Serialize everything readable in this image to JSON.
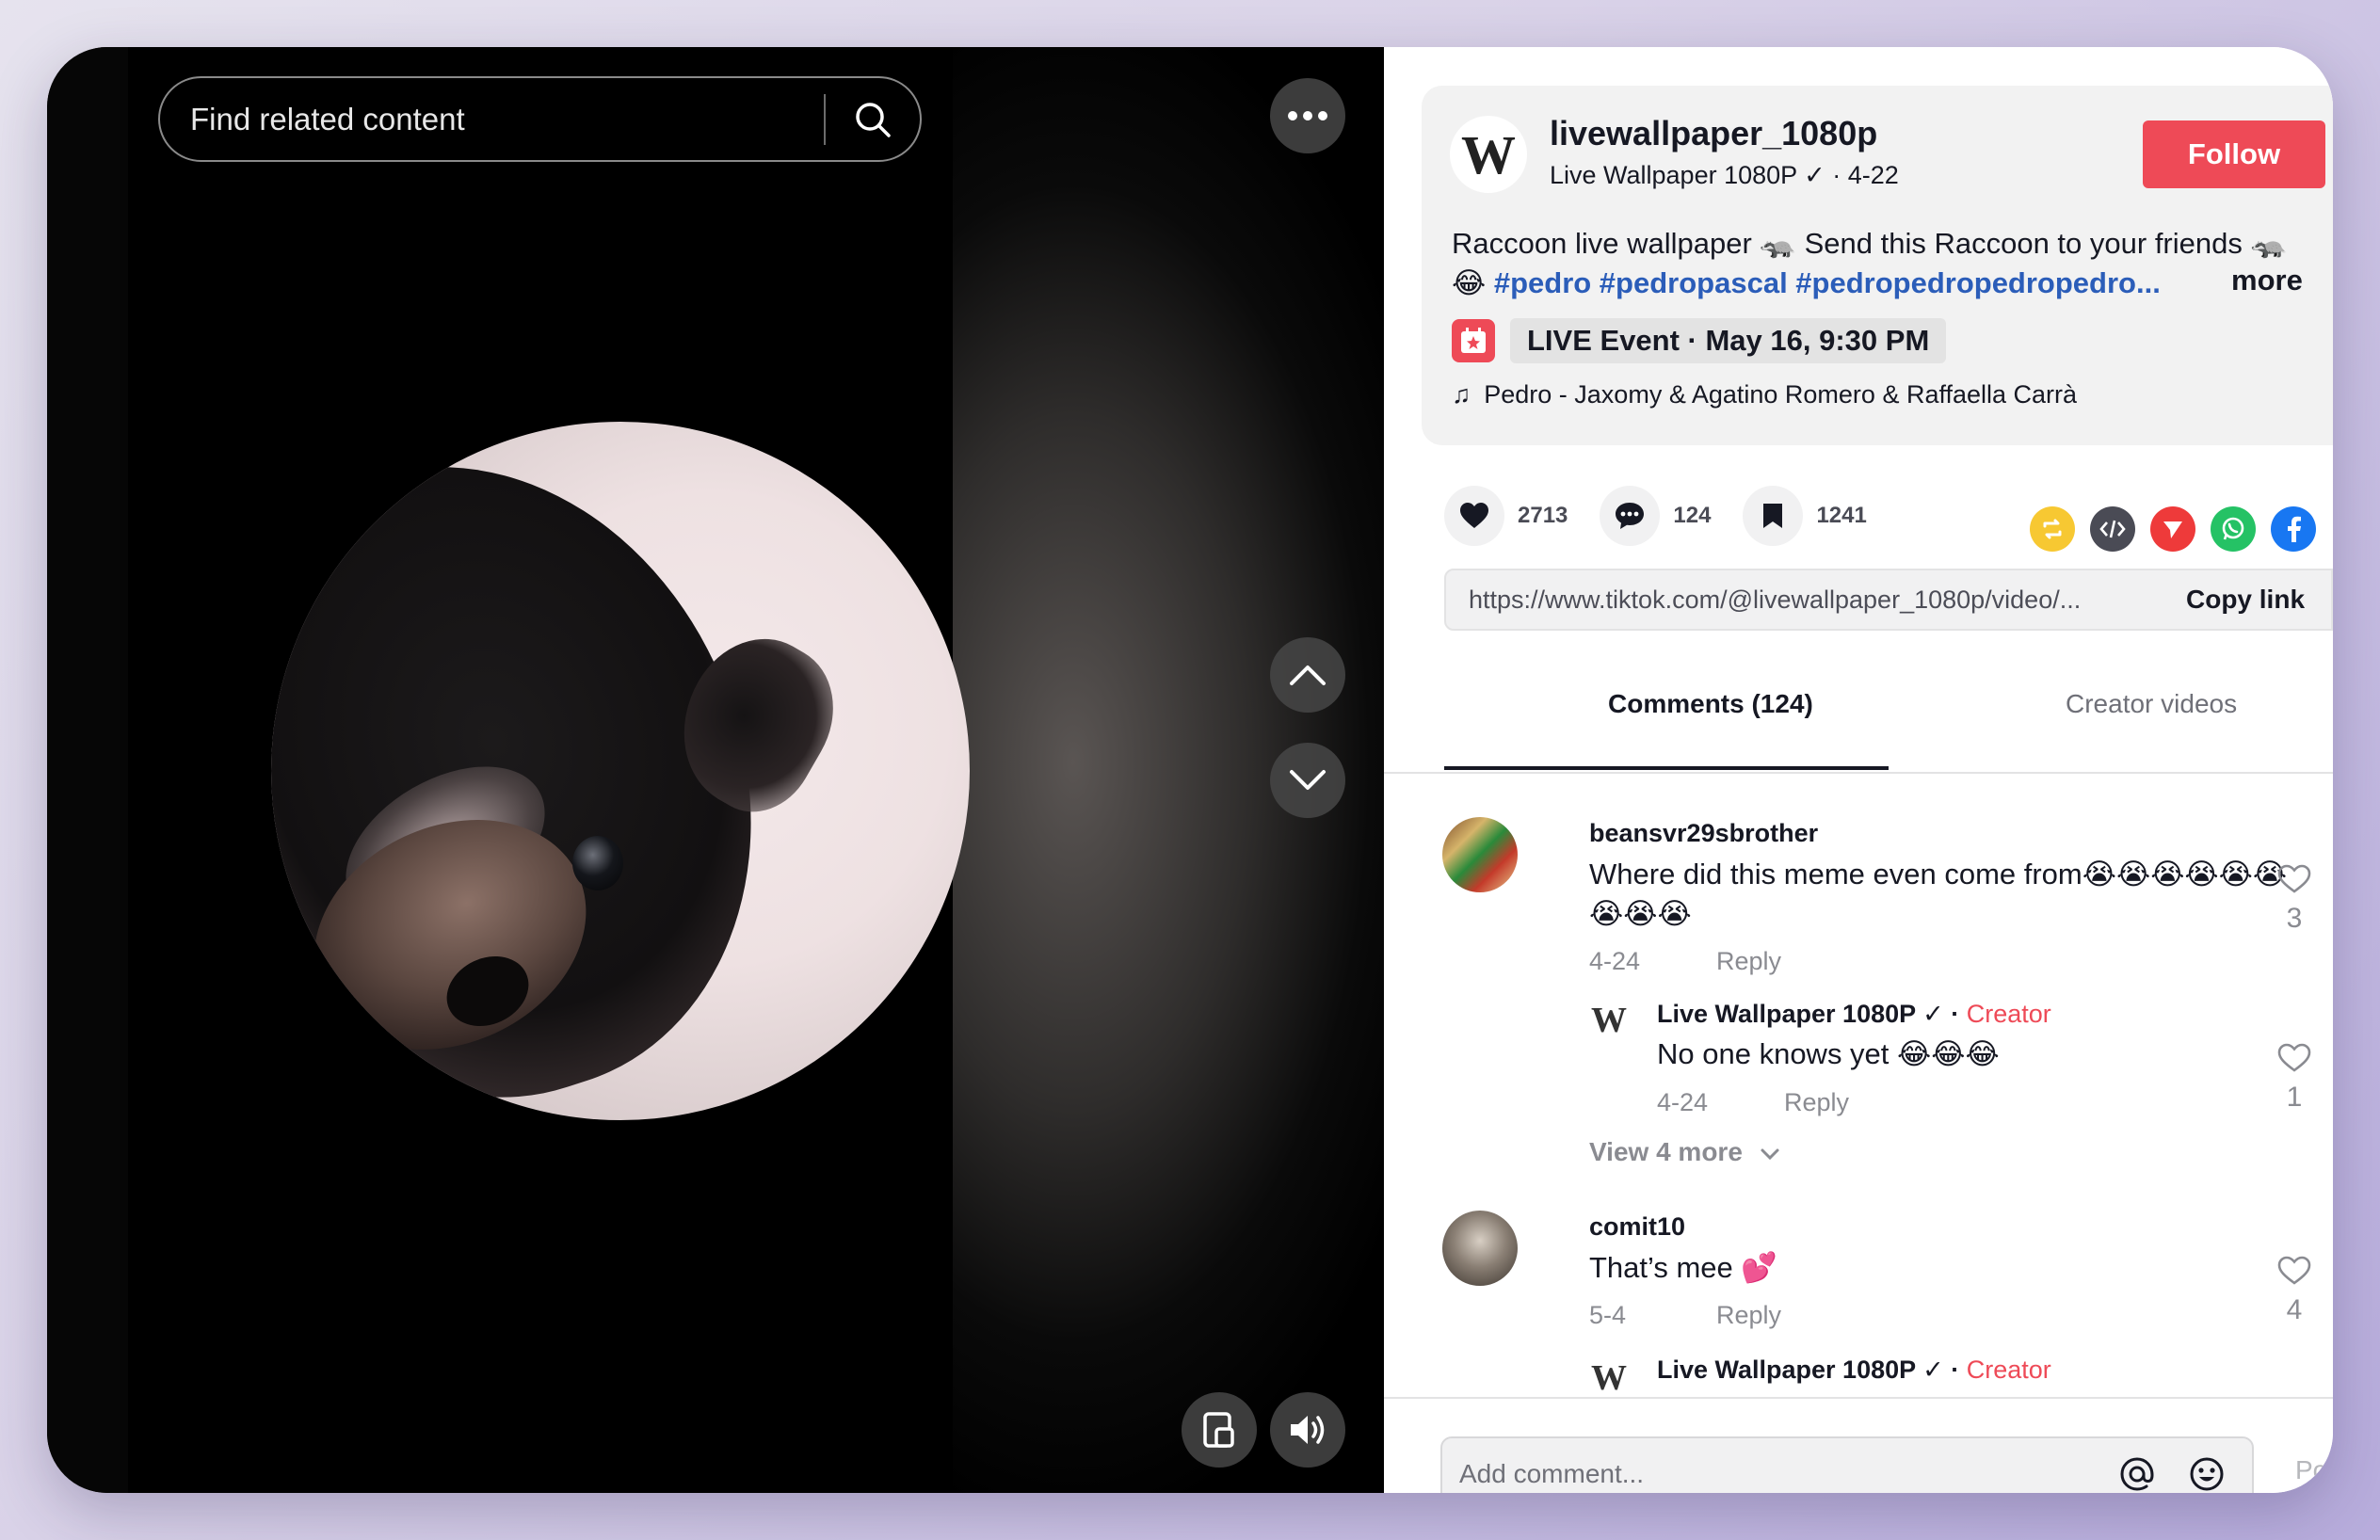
{
  "search": {
    "placeholder": "Find related content"
  },
  "author": {
    "avatar_letter": "W",
    "handle": "livewallpaper_1080p",
    "subtitle": "Live Wallpaper 1080P ✓ · 4-22",
    "follow_label": "Follow"
  },
  "description": {
    "text": "Raccoon live wallpaper 🦡 Send this Raccoon to your friends 🦡 😂 ",
    "hashtags": "#pedro #pedropascal #pedropedropedropedro...",
    "more_label": "more"
  },
  "live_event": {
    "label": "LIVE Event · May 16, 9:30 PM"
  },
  "music": {
    "note_icon": "♫",
    "title": "Pedro - Jaxomy & Agatino Romero & Raffaella Carrà"
  },
  "actions": {
    "likes": "2713",
    "comments": "124",
    "saves": "1241"
  },
  "link": {
    "url": "https://www.tiktok.com/@livewallpaper_1080p/video/...",
    "copy_label": "Copy link"
  },
  "tabs": {
    "comments": "Comments (124)",
    "creator_videos": "Creator videos"
  },
  "comments": [
    {
      "user": "beansvr29sbrother",
      "text_line1": "Where did this meme even come from😭😭😭😭😭😭",
      "text_line2": "😭😭😭",
      "date": "4-24",
      "reply_label": "Reply",
      "likes": "3",
      "reply": {
        "user": "Live Wallpaper 1080P ✓ · ",
        "creator_tag": "Creator",
        "text": "No one knows yet 😂😂😂",
        "date": "4-24",
        "reply_label": "Reply",
        "likes": "1"
      },
      "view_more": "View 4 more"
    },
    {
      "user": "comit10",
      "text": "That’s mee 💕",
      "date": "5-4",
      "reply_label": "Reply",
      "likes": "4",
      "reply": {
        "user": "Live Wallpaper 1080P ✓ · ",
        "creator_tag": "Creator"
      }
    }
  ],
  "composer": {
    "placeholder": "Add comment...",
    "post_label": "Post"
  },
  "colors": {
    "accent": "#ee4a57",
    "hashtag": "#2b5db9",
    "text": "#161823",
    "muted": "#8a8b91"
  }
}
